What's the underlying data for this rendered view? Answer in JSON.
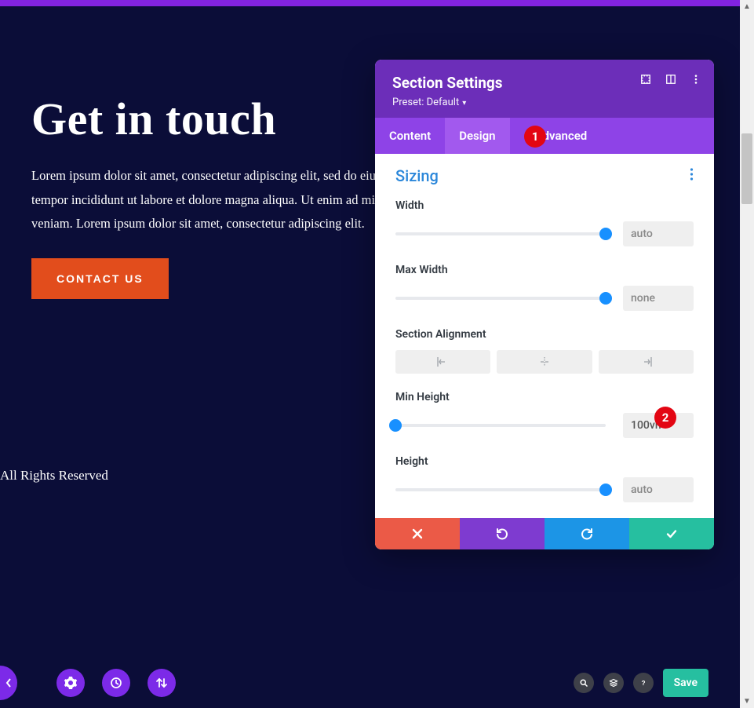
{
  "hero": {
    "heading": "Get in touch",
    "body": "Lorem ipsum dolor sit amet, consectetur adipiscing elit, sed do eiusmod tempor incididunt ut labore et dolore magna aliqua. Ut enim ad minim veniam. Lorem ipsum dolor sit amet, consectetur adipiscing elit.",
    "cta": "CONTACT US"
  },
  "footer": {
    "text": "All Rights Reserved"
  },
  "modal": {
    "title": "Section Settings",
    "preset": "Preset: Default",
    "tabs": {
      "content": "Content",
      "design": "Design",
      "advanced": "Advanced",
      "active": "design"
    },
    "group": "Sizing",
    "fields": {
      "width": {
        "label": "Width",
        "value": "auto",
        "pos": 100
      },
      "max_width": {
        "label": "Max Width",
        "value": "none",
        "pos": 100
      },
      "alignment": {
        "label": "Section Alignment"
      },
      "min_height": {
        "label": "Min Height",
        "value": "100vh",
        "pos": 0
      },
      "height": {
        "label": "Height",
        "value": "auto",
        "pos": 100
      }
    }
  },
  "annotations": {
    "b1": "1",
    "b2": "2"
  },
  "bottom": {
    "save": "Save"
  }
}
